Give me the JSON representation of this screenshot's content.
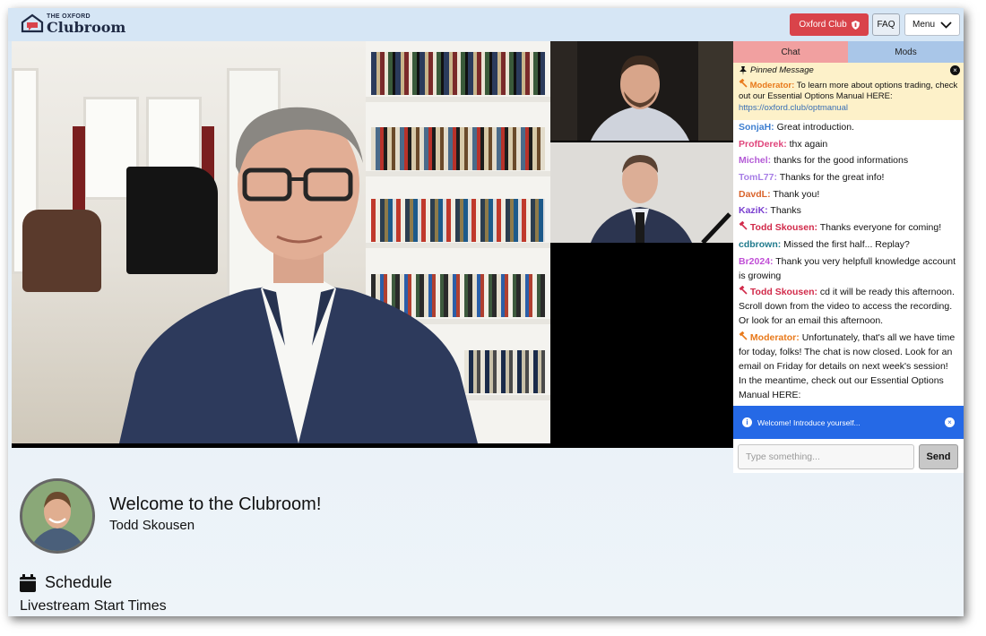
{
  "header": {
    "logo_small": "THE OXFORD",
    "logo_big": "Clubroom",
    "oxford_club_label": "Oxford Club",
    "faq_label": "FAQ",
    "menu_label": "Menu"
  },
  "chat": {
    "tabs": [
      {
        "label": "Chat"
      },
      {
        "label": "Mods"
      }
    ],
    "pinned": {
      "title": "Pinned Message",
      "author": "Moderator:",
      "text": "To learn more about options trading, check out our Essential Options Manual HERE:",
      "link": "https://oxford.club/optmanual"
    },
    "messages": [
      {
        "user": "SonjaH:",
        "text": "Great introduction.",
        "color": "#3f7fd0",
        "mod": false
      },
      {
        "user": "ProfDerek:",
        "text": "thx again",
        "color": "#e0457b",
        "mod": false
      },
      {
        "user": "Michel:",
        "text": "thanks for the good informations",
        "color": "#b45bd6",
        "mod": false
      },
      {
        "user": "TomL77:",
        "text": "Thanks for the great info!",
        "color": "#a77ee6",
        "mod": false
      },
      {
        "user": "DavdL:",
        "text": "Thank you!",
        "color": "#d9632b",
        "mod": false
      },
      {
        "user": "KaziK:",
        "text": "Thanks",
        "color": "#7a3fd0",
        "mod": false
      },
      {
        "user": "Todd Skousen:",
        "text": "Thanks everyone for coming!",
        "color": "#d12a4a",
        "mod": true
      },
      {
        "user": "cdbrown:",
        "text": "Missed the first half... Replay?",
        "color": "#1f7a8c",
        "mod": false
      },
      {
        "user": "Br2024:",
        "text": "Thank you very helpfull knowledge account is growing",
        "color": "#c04fd6",
        "mod": false
      },
      {
        "user": "Todd Skousen:",
        "text": "cd it will be ready this afternoon. Scroll down from the video to access the recording. Or look for an email this afternoon.",
        "color": "#d12a4a",
        "mod": true
      },
      {
        "user": "Moderator:",
        "text": "Unfortunately, that's all we have time for today, folks! The chat is now closed. Look for an email on Friday for details on next week's session! In the meantime, check out our Essential Options Manual HERE:",
        "color": "#e8791b",
        "mod": true
      }
    ],
    "welcome_notice": "Welcome! Introduce yourself...",
    "input_placeholder": "Type something...",
    "send_label": "Send"
  },
  "main": {
    "welcome_title": "Welcome to the Clubroom!",
    "host_name": "Todd Skousen",
    "schedule_title": "Schedule",
    "schedule_subtitle": "Livestream Start Times"
  }
}
